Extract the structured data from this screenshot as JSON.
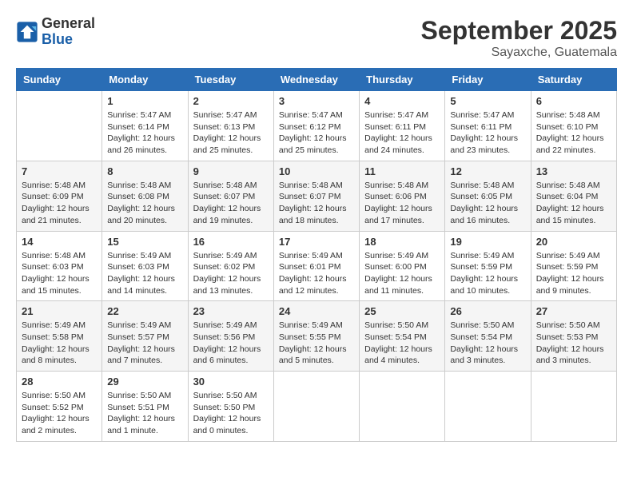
{
  "logo": {
    "line1": "General",
    "line2": "Blue"
  },
  "title": "September 2025",
  "subtitle": "Sayaxche, Guatemala",
  "days_of_week": [
    "Sunday",
    "Monday",
    "Tuesday",
    "Wednesday",
    "Thursday",
    "Friday",
    "Saturday"
  ],
  "weeks": [
    [
      {
        "day": "",
        "info": ""
      },
      {
        "day": "1",
        "info": "Sunrise: 5:47 AM\nSunset: 6:14 PM\nDaylight: 12 hours\nand 26 minutes."
      },
      {
        "day": "2",
        "info": "Sunrise: 5:47 AM\nSunset: 6:13 PM\nDaylight: 12 hours\nand 25 minutes."
      },
      {
        "day": "3",
        "info": "Sunrise: 5:47 AM\nSunset: 6:12 PM\nDaylight: 12 hours\nand 25 minutes."
      },
      {
        "day": "4",
        "info": "Sunrise: 5:47 AM\nSunset: 6:11 PM\nDaylight: 12 hours\nand 24 minutes."
      },
      {
        "day": "5",
        "info": "Sunrise: 5:47 AM\nSunset: 6:11 PM\nDaylight: 12 hours\nand 23 minutes."
      },
      {
        "day": "6",
        "info": "Sunrise: 5:48 AM\nSunset: 6:10 PM\nDaylight: 12 hours\nand 22 minutes."
      }
    ],
    [
      {
        "day": "7",
        "info": "Sunrise: 5:48 AM\nSunset: 6:09 PM\nDaylight: 12 hours\nand 21 minutes."
      },
      {
        "day": "8",
        "info": "Sunrise: 5:48 AM\nSunset: 6:08 PM\nDaylight: 12 hours\nand 20 minutes."
      },
      {
        "day": "9",
        "info": "Sunrise: 5:48 AM\nSunset: 6:07 PM\nDaylight: 12 hours\nand 19 minutes."
      },
      {
        "day": "10",
        "info": "Sunrise: 5:48 AM\nSunset: 6:07 PM\nDaylight: 12 hours\nand 18 minutes."
      },
      {
        "day": "11",
        "info": "Sunrise: 5:48 AM\nSunset: 6:06 PM\nDaylight: 12 hours\nand 17 minutes."
      },
      {
        "day": "12",
        "info": "Sunrise: 5:48 AM\nSunset: 6:05 PM\nDaylight: 12 hours\nand 16 minutes."
      },
      {
        "day": "13",
        "info": "Sunrise: 5:48 AM\nSunset: 6:04 PM\nDaylight: 12 hours\nand 15 minutes."
      }
    ],
    [
      {
        "day": "14",
        "info": "Sunrise: 5:48 AM\nSunset: 6:03 PM\nDaylight: 12 hours\nand 15 minutes."
      },
      {
        "day": "15",
        "info": "Sunrise: 5:49 AM\nSunset: 6:03 PM\nDaylight: 12 hours\nand 14 minutes."
      },
      {
        "day": "16",
        "info": "Sunrise: 5:49 AM\nSunset: 6:02 PM\nDaylight: 12 hours\nand 13 minutes."
      },
      {
        "day": "17",
        "info": "Sunrise: 5:49 AM\nSunset: 6:01 PM\nDaylight: 12 hours\nand 12 minutes."
      },
      {
        "day": "18",
        "info": "Sunrise: 5:49 AM\nSunset: 6:00 PM\nDaylight: 12 hours\nand 11 minutes."
      },
      {
        "day": "19",
        "info": "Sunrise: 5:49 AM\nSunset: 5:59 PM\nDaylight: 12 hours\nand 10 minutes."
      },
      {
        "day": "20",
        "info": "Sunrise: 5:49 AM\nSunset: 5:59 PM\nDaylight: 12 hours\nand 9 minutes."
      }
    ],
    [
      {
        "day": "21",
        "info": "Sunrise: 5:49 AM\nSunset: 5:58 PM\nDaylight: 12 hours\nand 8 minutes."
      },
      {
        "day": "22",
        "info": "Sunrise: 5:49 AM\nSunset: 5:57 PM\nDaylight: 12 hours\nand 7 minutes."
      },
      {
        "day": "23",
        "info": "Sunrise: 5:49 AM\nSunset: 5:56 PM\nDaylight: 12 hours\nand 6 minutes."
      },
      {
        "day": "24",
        "info": "Sunrise: 5:49 AM\nSunset: 5:55 PM\nDaylight: 12 hours\nand 5 minutes."
      },
      {
        "day": "25",
        "info": "Sunrise: 5:50 AM\nSunset: 5:54 PM\nDaylight: 12 hours\nand 4 minutes."
      },
      {
        "day": "26",
        "info": "Sunrise: 5:50 AM\nSunset: 5:54 PM\nDaylight: 12 hours\nand 3 minutes."
      },
      {
        "day": "27",
        "info": "Sunrise: 5:50 AM\nSunset: 5:53 PM\nDaylight: 12 hours\nand 3 minutes."
      }
    ],
    [
      {
        "day": "28",
        "info": "Sunrise: 5:50 AM\nSunset: 5:52 PM\nDaylight: 12 hours\nand 2 minutes."
      },
      {
        "day": "29",
        "info": "Sunrise: 5:50 AM\nSunset: 5:51 PM\nDaylight: 12 hours\nand 1 minute."
      },
      {
        "day": "30",
        "info": "Sunrise: 5:50 AM\nSunset: 5:50 PM\nDaylight: 12 hours\nand 0 minutes."
      },
      {
        "day": "",
        "info": ""
      },
      {
        "day": "",
        "info": ""
      },
      {
        "day": "",
        "info": ""
      },
      {
        "day": "",
        "info": ""
      }
    ]
  ]
}
